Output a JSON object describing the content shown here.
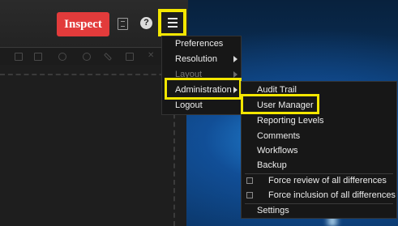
{
  "header": {
    "inspect_label": "Inspect",
    "help_glyph": "?",
    "icons": [
      "notebook-icon",
      "help-icon",
      "hamburger-menu-icon"
    ]
  },
  "main_menu": {
    "items": [
      {
        "label": "Preferences",
        "has_submenu": false,
        "enabled": true
      },
      {
        "label": "Resolution",
        "has_submenu": true,
        "enabled": true
      },
      {
        "label": "Layout",
        "has_submenu": true,
        "enabled": false
      },
      {
        "label": "Administration",
        "has_submenu": true,
        "enabled": true,
        "highlighted": true
      },
      {
        "label": "Logout",
        "has_submenu": false,
        "enabled": true
      }
    ]
  },
  "admin_submenu": {
    "items": [
      {
        "label": "Audit Trail"
      },
      {
        "label": "User Manager",
        "highlighted": true
      },
      {
        "label": "Reporting Levels"
      },
      {
        "label": "Comments"
      },
      {
        "label": "Workflows"
      },
      {
        "label": "Backup"
      }
    ],
    "checkbox_items": [
      {
        "label": "Force review of all differences",
        "checked": false
      },
      {
        "label": "Force inclusion of all differences",
        "checked": false
      }
    ],
    "footer_item": {
      "label": "Settings"
    }
  },
  "colors": {
    "inspect_button": "#e23b3b",
    "highlight_outline": "#f3e600",
    "menu_background": "#171717"
  }
}
